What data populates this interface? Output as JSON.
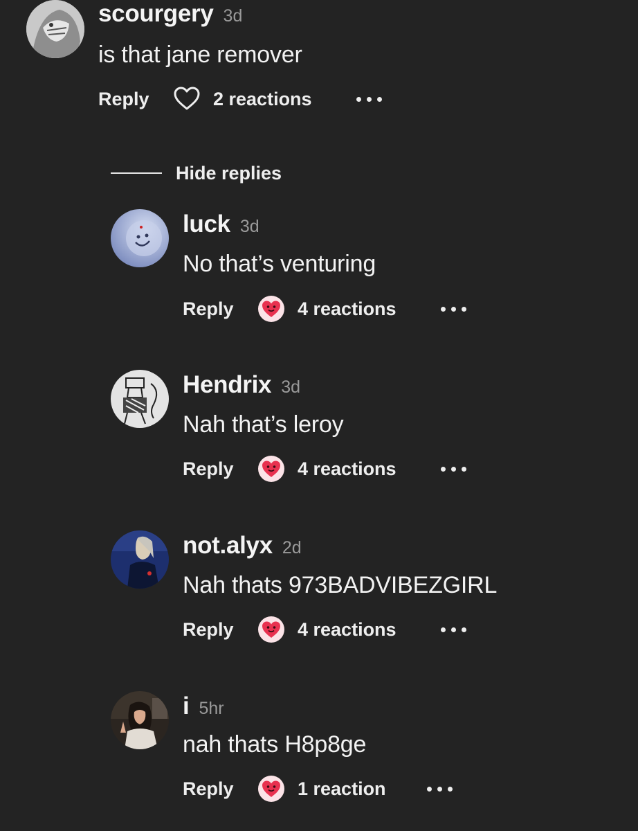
{
  "comment": {
    "username": "scourgery",
    "time": "3d",
    "text": "is that jane remover",
    "reply_label": "Reply",
    "reactions": "2 reactions",
    "reacted": false
  },
  "hide_replies_label": "Hide replies",
  "replies": [
    {
      "username": "luck",
      "time": "3d",
      "text": "No that’s venturing",
      "reply_label": "Reply",
      "reactions": "4 reactions",
      "reacted": true
    },
    {
      "username": "Hendrix",
      "time": "3d",
      "text": "Nah that’s leroy",
      "reply_label": "Reply",
      "reactions": "4 reactions",
      "reacted": true
    },
    {
      "username": "not.alyx",
      "time": "2d",
      "text": "Nah thats 973BADVIBEZGIRL",
      "reply_label": "Reply",
      "reactions": "4 reactions",
      "reacted": true
    },
    {
      "username": "i",
      "time": "5hr",
      "text": "nah thats H8p8ge",
      "reply_label": "Reply",
      "reactions": "1 reaction",
      "reacted": true
    }
  ],
  "colors": {
    "background": "#232323",
    "reaction_heart": "#e8314f",
    "reaction_bubble": "#fbe3e7"
  },
  "icons": {
    "reaction_empty": "heart-outline-icon",
    "reaction_filled": "heart-face-icon",
    "more": "more-dots-icon"
  }
}
